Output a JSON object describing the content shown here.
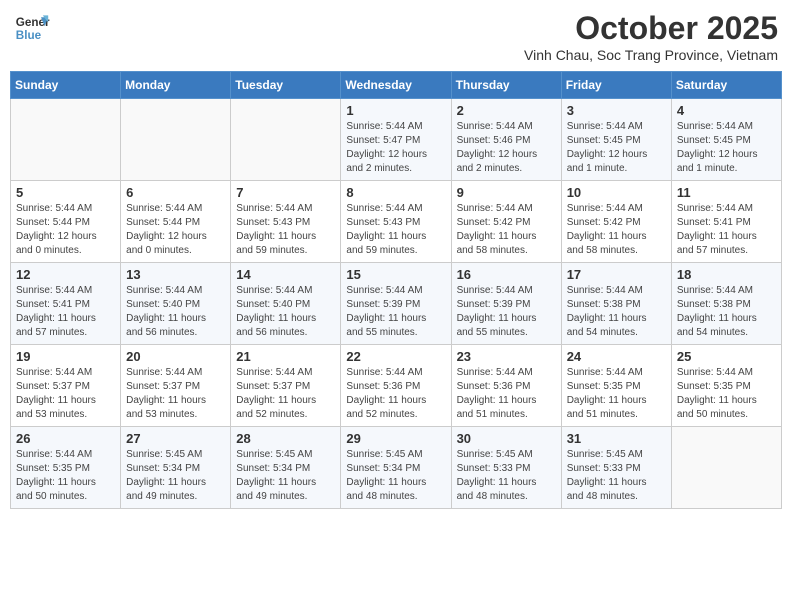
{
  "header": {
    "logo_line1": "General",
    "logo_line2": "Blue",
    "month": "October 2025",
    "location": "Vinh Chau, Soc Trang Province, Vietnam"
  },
  "days_of_week": [
    "Sunday",
    "Monday",
    "Tuesday",
    "Wednesday",
    "Thursday",
    "Friday",
    "Saturday"
  ],
  "weeks": [
    [
      {
        "day": "",
        "info": ""
      },
      {
        "day": "",
        "info": ""
      },
      {
        "day": "",
        "info": ""
      },
      {
        "day": "1",
        "info": "Sunrise: 5:44 AM\nSunset: 5:47 PM\nDaylight: 12 hours and 2 minutes."
      },
      {
        "day": "2",
        "info": "Sunrise: 5:44 AM\nSunset: 5:46 PM\nDaylight: 12 hours and 2 minutes."
      },
      {
        "day": "3",
        "info": "Sunrise: 5:44 AM\nSunset: 5:45 PM\nDaylight: 12 hours and 1 minute."
      },
      {
        "day": "4",
        "info": "Sunrise: 5:44 AM\nSunset: 5:45 PM\nDaylight: 12 hours and 1 minute."
      }
    ],
    [
      {
        "day": "5",
        "info": "Sunrise: 5:44 AM\nSunset: 5:44 PM\nDaylight: 12 hours and 0 minutes."
      },
      {
        "day": "6",
        "info": "Sunrise: 5:44 AM\nSunset: 5:44 PM\nDaylight: 12 hours and 0 minutes."
      },
      {
        "day": "7",
        "info": "Sunrise: 5:44 AM\nSunset: 5:43 PM\nDaylight: 11 hours and 59 minutes."
      },
      {
        "day": "8",
        "info": "Sunrise: 5:44 AM\nSunset: 5:43 PM\nDaylight: 11 hours and 59 minutes."
      },
      {
        "day": "9",
        "info": "Sunrise: 5:44 AM\nSunset: 5:42 PM\nDaylight: 11 hours and 58 minutes."
      },
      {
        "day": "10",
        "info": "Sunrise: 5:44 AM\nSunset: 5:42 PM\nDaylight: 11 hours and 58 minutes."
      },
      {
        "day": "11",
        "info": "Sunrise: 5:44 AM\nSunset: 5:41 PM\nDaylight: 11 hours and 57 minutes."
      }
    ],
    [
      {
        "day": "12",
        "info": "Sunrise: 5:44 AM\nSunset: 5:41 PM\nDaylight: 11 hours and 57 minutes."
      },
      {
        "day": "13",
        "info": "Sunrise: 5:44 AM\nSunset: 5:40 PM\nDaylight: 11 hours and 56 minutes."
      },
      {
        "day": "14",
        "info": "Sunrise: 5:44 AM\nSunset: 5:40 PM\nDaylight: 11 hours and 56 minutes."
      },
      {
        "day": "15",
        "info": "Sunrise: 5:44 AM\nSunset: 5:39 PM\nDaylight: 11 hours and 55 minutes."
      },
      {
        "day": "16",
        "info": "Sunrise: 5:44 AM\nSunset: 5:39 PM\nDaylight: 11 hours and 55 minutes."
      },
      {
        "day": "17",
        "info": "Sunrise: 5:44 AM\nSunset: 5:38 PM\nDaylight: 11 hours and 54 minutes."
      },
      {
        "day": "18",
        "info": "Sunrise: 5:44 AM\nSunset: 5:38 PM\nDaylight: 11 hours and 54 minutes."
      }
    ],
    [
      {
        "day": "19",
        "info": "Sunrise: 5:44 AM\nSunset: 5:37 PM\nDaylight: 11 hours and 53 minutes."
      },
      {
        "day": "20",
        "info": "Sunrise: 5:44 AM\nSunset: 5:37 PM\nDaylight: 11 hours and 53 minutes."
      },
      {
        "day": "21",
        "info": "Sunrise: 5:44 AM\nSunset: 5:37 PM\nDaylight: 11 hours and 52 minutes."
      },
      {
        "day": "22",
        "info": "Sunrise: 5:44 AM\nSunset: 5:36 PM\nDaylight: 11 hours and 52 minutes."
      },
      {
        "day": "23",
        "info": "Sunrise: 5:44 AM\nSunset: 5:36 PM\nDaylight: 11 hours and 51 minutes."
      },
      {
        "day": "24",
        "info": "Sunrise: 5:44 AM\nSunset: 5:35 PM\nDaylight: 11 hours and 51 minutes."
      },
      {
        "day": "25",
        "info": "Sunrise: 5:44 AM\nSunset: 5:35 PM\nDaylight: 11 hours and 50 minutes."
      }
    ],
    [
      {
        "day": "26",
        "info": "Sunrise: 5:44 AM\nSunset: 5:35 PM\nDaylight: 11 hours and 50 minutes."
      },
      {
        "day": "27",
        "info": "Sunrise: 5:45 AM\nSunset: 5:34 PM\nDaylight: 11 hours and 49 minutes."
      },
      {
        "day": "28",
        "info": "Sunrise: 5:45 AM\nSunset: 5:34 PM\nDaylight: 11 hours and 49 minutes."
      },
      {
        "day": "29",
        "info": "Sunrise: 5:45 AM\nSunset: 5:34 PM\nDaylight: 11 hours and 48 minutes."
      },
      {
        "day": "30",
        "info": "Sunrise: 5:45 AM\nSunset: 5:33 PM\nDaylight: 11 hours and 48 minutes."
      },
      {
        "day": "31",
        "info": "Sunrise: 5:45 AM\nSunset: 5:33 PM\nDaylight: 11 hours and 48 minutes."
      },
      {
        "day": "",
        "info": ""
      }
    ]
  ]
}
